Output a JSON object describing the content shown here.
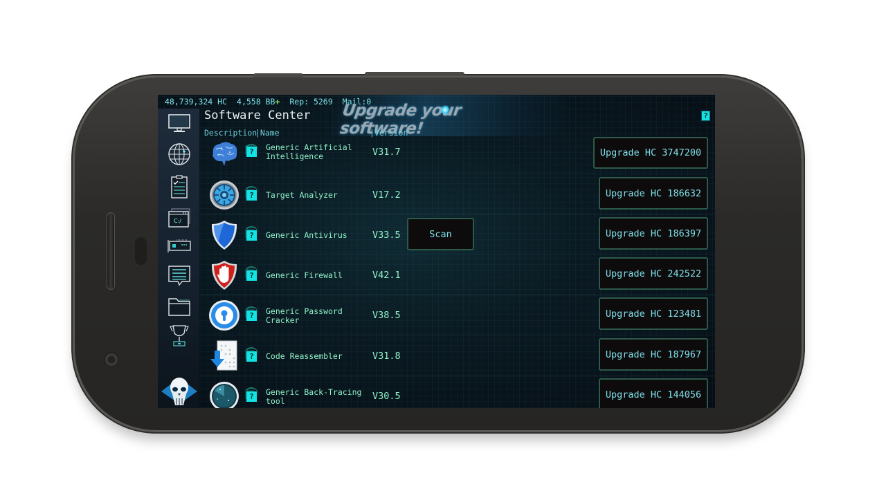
{
  "status_bar": {
    "hc": "48,739,324 HC",
    "bb": "4,558 BB",
    "bb_plus": "+",
    "rep": "Rep: 5269",
    "mail": "Mail:0"
  },
  "sidebar": {
    "items": [
      {
        "name": "computer",
        "icon": "monitor-icon"
      },
      {
        "name": "world",
        "icon": "globe-icon"
      },
      {
        "name": "tasks",
        "icon": "clipboard-icon"
      },
      {
        "name": "terminal",
        "icon": "terminal-icon",
        "label": "C:/"
      },
      {
        "name": "hardware",
        "icon": "hardware-card-icon"
      },
      {
        "name": "messages",
        "icon": "chat-icon"
      },
      {
        "name": "files",
        "icon": "folder-icon"
      },
      {
        "name": "achievements",
        "icon": "trophy-icon"
      },
      {
        "name": "profile",
        "icon": "skull-avatar-icon"
      }
    ]
  },
  "header": {
    "title": "Software Center",
    "banner": "Upgrade your software!",
    "help": "?",
    "columns": {
      "description": "Description",
      "name": "|Name",
      "version": "|Version"
    }
  },
  "software": [
    {
      "name": "Generic Artificial Intelligence",
      "version": "V31.7",
      "upgrade": "Upgrade HC 3747200",
      "icon": "brain-icon",
      "help": "?"
    },
    {
      "name": "Target Analyzer",
      "version": "V17.2",
      "upgrade": "Upgrade HC 186632",
      "icon": "target-analyzer-icon",
      "help": "?"
    },
    {
      "name": "Generic Antivirus",
      "version": "V33.5",
      "upgrade": "Upgrade HC 186397",
      "icon": "shield-icon",
      "help": "?",
      "action": "Scan"
    },
    {
      "name": "Generic Firewall",
      "version": "V42.1",
      "upgrade": "Upgrade HC 242522",
      "icon": "firewall-hand-icon",
      "help": "?"
    },
    {
      "name": "Generic Password Cracker",
      "version": "V38.5",
      "upgrade": "Upgrade HC 123481",
      "icon": "keyhole-icon",
      "help": "?"
    },
    {
      "name": "Code Reassembler",
      "version": "V31.8",
      "upgrade": "Upgrade HC 187967",
      "icon": "code-download-icon",
      "help": "?"
    },
    {
      "name": "Generic Back-Tracing tool",
      "version": "V30.5",
      "upgrade": "Upgrade HC 144056",
      "icon": "radar-icon",
      "help": "?"
    }
  ]
}
